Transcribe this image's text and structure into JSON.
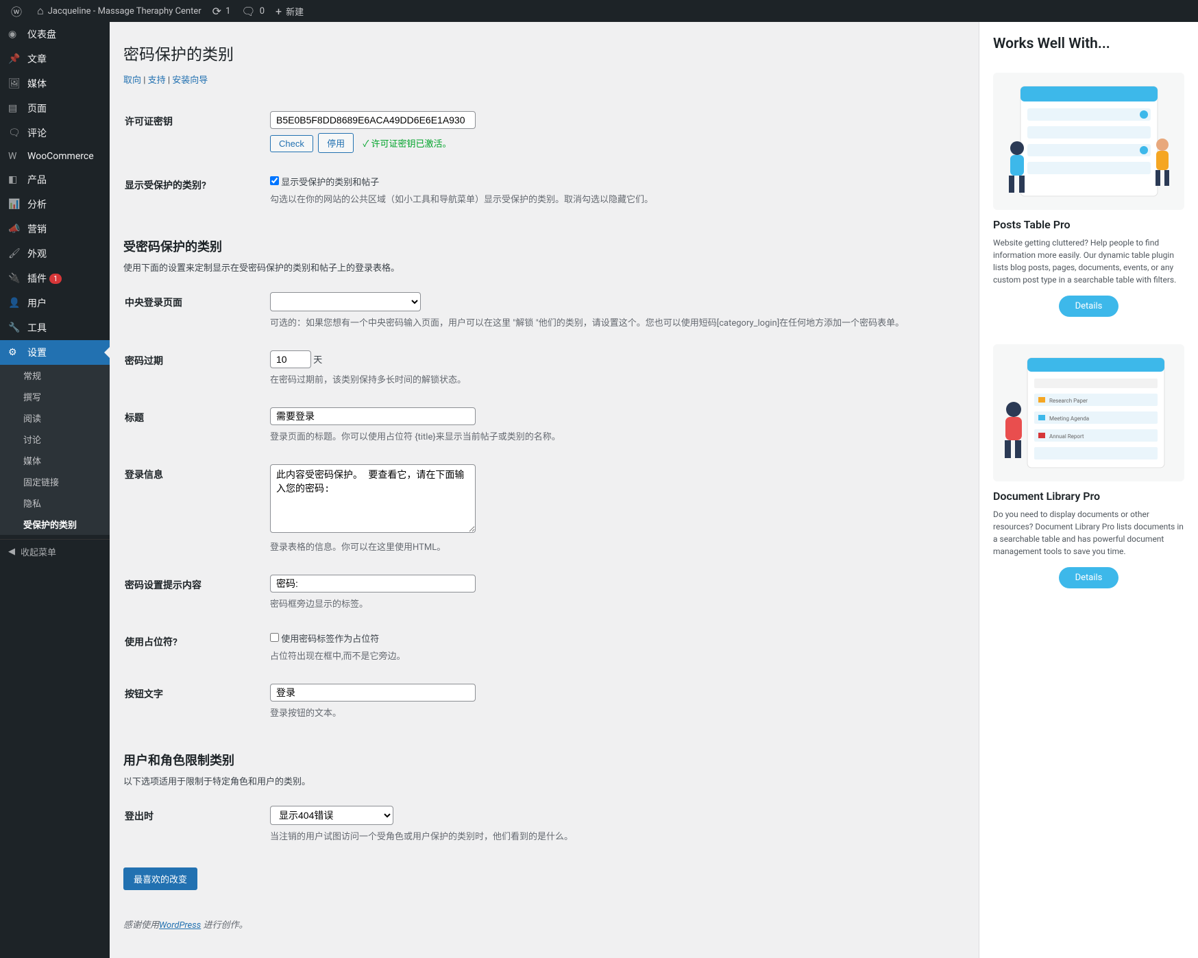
{
  "adminbar": {
    "site_name": "Jacqueline - Massage Theraphy Center",
    "updates": "1",
    "comments": "0",
    "new": "新建"
  },
  "sidebar": {
    "items": [
      {
        "label": "仪表盘"
      },
      {
        "label": "文章"
      },
      {
        "label": "媒体"
      },
      {
        "label": "页面"
      },
      {
        "label": "评论"
      },
      {
        "label": "WooCommerce"
      },
      {
        "label": "产品"
      },
      {
        "label": "分析"
      },
      {
        "label": "营销"
      },
      {
        "label": "外观"
      },
      {
        "label": "插件",
        "badge": "1"
      },
      {
        "label": "用户"
      },
      {
        "label": "工具"
      },
      {
        "label": "设置"
      }
    ],
    "submenu": [
      {
        "label": "常规"
      },
      {
        "label": "撰写"
      },
      {
        "label": "阅读"
      },
      {
        "label": "讨论"
      },
      {
        "label": "媒体"
      },
      {
        "label": "固定链接"
      },
      {
        "label": "隐私"
      },
      {
        "label": "受保护的类别"
      }
    ],
    "collapse": "收起菜单"
  },
  "page": {
    "title": "密码保护的类别",
    "subnav": {
      "docs": "取向",
      "support": "支持",
      "setup": "安装向导"
    },
    "license": {
      "label": "许可证密钥",
      "value": "B5E0B5F8DD8689E6ACA49DD6E6E1A930",
      "check": "Check",
      "deactivate": "停用",
      "status": "许可证密钥已激活。"
    },
    "show_protected": {
      "label": "显示受保护的类别?",
      "checkbox": "显示受保护的类别和帖子",
      "desc": "勾选以在你的网站的公共区域（如小工具和导航菜单）显示受保护的类别。取消勾选以隐藏它们。"
    },
    "section1": {
      "heading": "受密码保护的类别",
      "desc": "使用下面的设置来定制显示在受密码保护的类别和帖子上的登录表格。"
    },
    "central_login": {
      "label": "中央登录页面",
      "desc": "可选的：如果您想有一个中央密码输入页面，用户可以在这里 \"解锁 \"他们的类别，请设置这个。您也可以使用短码[category_login]在任何地方添加一个密码表单。"
    },
    "expiry": {
      "label": "密码过期",
      "value": "10",
      "unit": "天",
      "desc": "在密码过期前，该类别保持多长时间的解锁状态。"
    },
    "form_title": {
      "label": "标题",
      "value": "需要登录",
      "desc": "登录页面的标题。你可以使用占位符 {title}来显示当前帖子或类别的名称。"
    },
    "login_msg": {
      "label": "登录信息",
      "value": "此内容受密码保护。 要查看它，请在下面输入您的密码:",
      "desc": "登录表格的信息。你可以在这里使用HTML。"
    },
    "pwd_label": {
      "label": "密码设置提示内容",
      "value": "密码:",
      "desc": "密码框旁边显示的标签。"
    },
    "placeholder": {
      "label": "使用占位符?",
      "checkbox": "使用密码标签作为占位符",
      "desc": "占位符出现在框中,而不是它旁边。"
    },
    "button": {
      "label": "按钮文字",
      "value": "登录",
      "desc": "登录按钮的文本。"
    },
    "section2": {
      "heading": "用户和角色限制类别",
      "desc": "以下选项适用于限制于特定角色和用户的类别。"
    },
    "logout": {
      "label": "登出时",
      "value": "显示404错误",
      "desc": "当注销的用户试图访问一个受角色或用户保护的类别时，他们看到的是什么。"
    },
    "save": "最喜欢的改变"
  },
  "footer": {
    "prefix": "感谢使用",
    "link": "WordPress",
    "suffix": "进行创作。"
  },
  "rightbar": {
    "heading": "Works Well With...",
    "promo1": {
      "title": "Posts Table Pro",
      "desc": "Website getting cluttered? Help people to find information more easily. Our dynamic table plugin lists blog posts, pages, documents, events, or any custom post type in a searchable table with filters.",
      "cta": "Details"
    },
    "promo2": {
      "title": "Document Library Pro",
      "desc": "Do you need to display documents or other resources? Document Library Pro lists documents in a searchable table and has powerful document management tools to save you time.",
      "cta": "Details"
    }
  }
}
